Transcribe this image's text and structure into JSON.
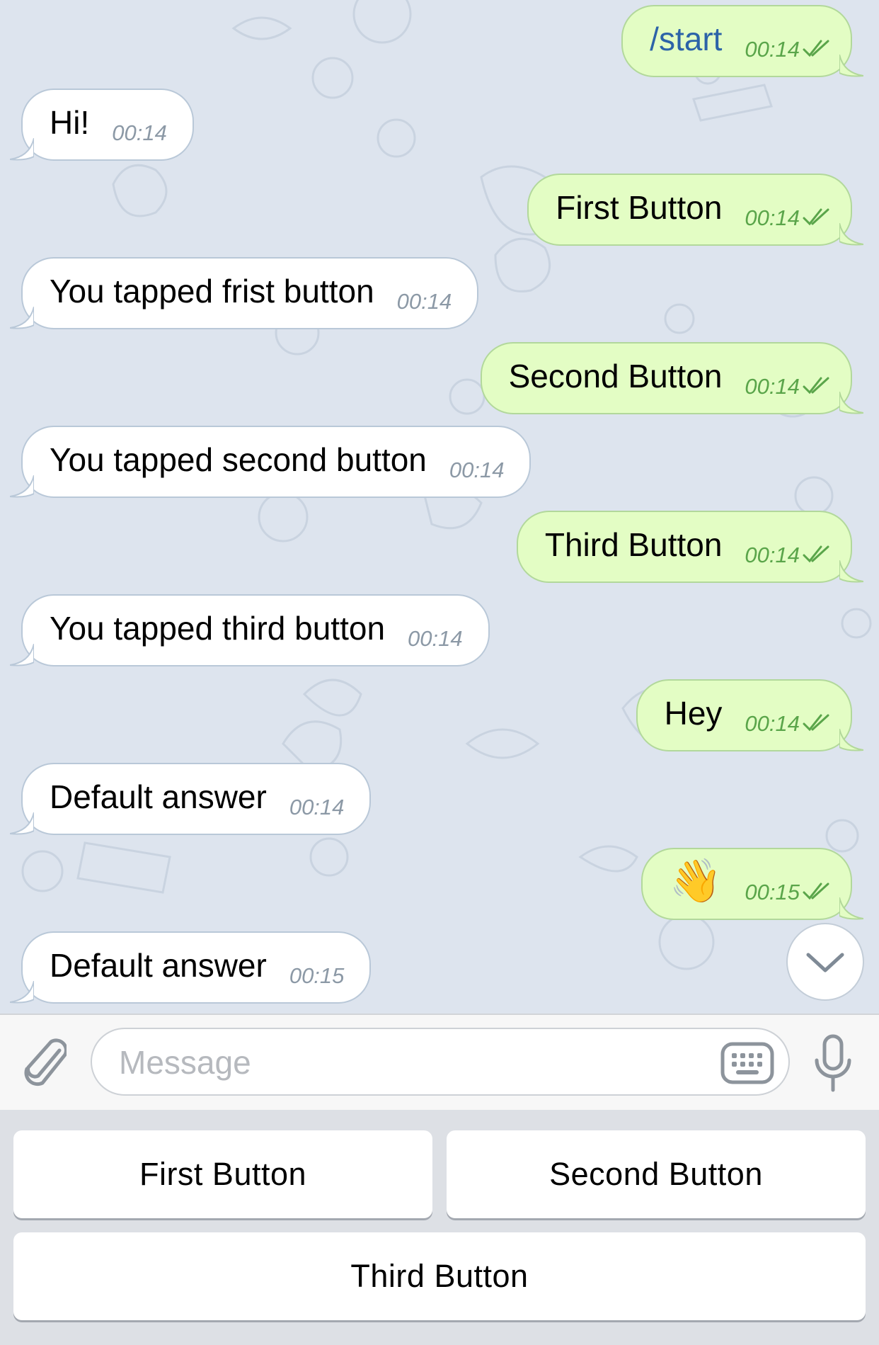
{
  "chat": {
    "messages": [
      {
        "dir": "out",
        "text": "/start",
        "time": "00:14"
      },
      {
        "dir": "in",
        "text": "Hi!",
        "time": "00:14"
      },
      {
        "dir": "out",
        "text": "First Button",
        "time": "00:14"
      },
      {
        "dir": "in",
        "text": "You tapped frist button",
        "time": "00:14"
      },
      {
        "dir": "out",
        "text": "Second Button",
        "time": "00:14"
      },
      {
        "dir": "in",
        "text": "You tapped second button",
        "time": "00:14"
      },
      {
        "dir": "out",
        "text": "Third Button",
        "time": "00:14"
      },
      {
        "dir": "in",
        "text": "You tapped third button",
        "time": "00:14"
      },
      {
        "dir": "out",
        "text": "Hey",
        "time": "00:14"
      },
      {
        "dir": "in",
        "text": "Default answer",
        "time": "00:14"
      },
      {
        "dir": "out",
        "text": "👋",
        "time": "00:15"
      },
      {
        "dir": "in",
        "text": "Default answer",
        "time": "00:15"
      }
    ]
  },
  "input": {
    "placeholder": "Message",
    "value": ""
  },
  "keyboard": {
    "buttons": [
      {
        "label": "First Button"
      },
      {
        "label": "Second Button"
      },
      {
        "label": "Third Button"
      }
    ]
  },
  "icons": {
    "attach": "paperclip-icon",
    "keyboard": "keyboard-icon",
    "mic": "microphone-icon",
    "scroll": "chevron-down-icon",
    "read_status": "double-check-icon"
  },
  "colors": {
    "chat_background": "#dde4ee",
    "incoming_bubble": "#ffffff",
    "outgoing_bubble": "#e3fdc4",
    "outgoing_time": "#5aa54a",
    "incoming_time": "#8c99a6",
    "command_text": "#2c63a8"
  }
}
